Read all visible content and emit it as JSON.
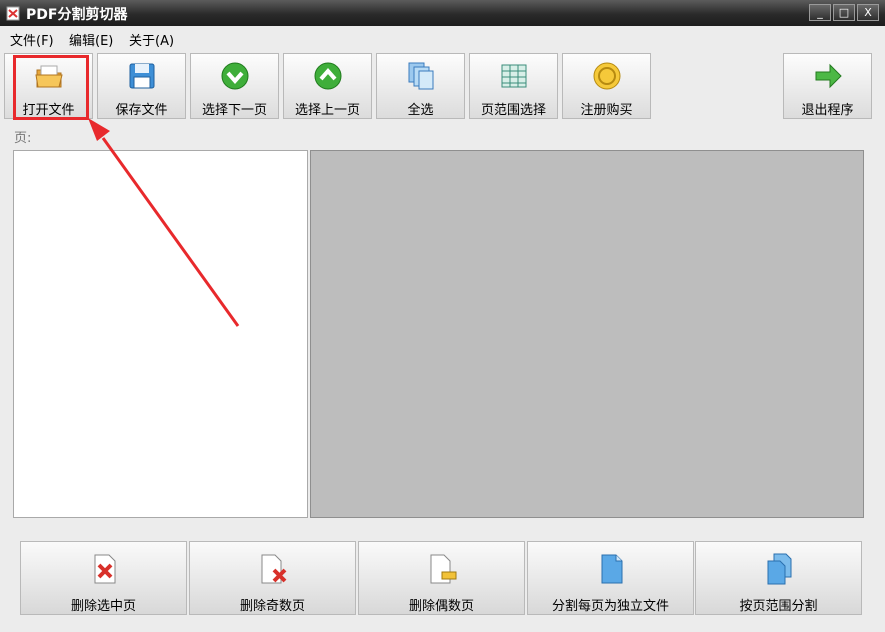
{
  "window": {
    "title": "PDF分割剪切器",
    "buttons": [
      "_",
      "□",
      "X"
    ]
  },
  "menu": [
    "文件(F)",
    "编辑(E)",
    "关于(A)"
  ],
  "toolbar": [
    {
      "label": "打开文件",
      "icon": "open-folder-icon"
    },
    {
      "label": "保存文件",
      "icon": "save-disk-icon"
    },
    {
      "label": "选择下一页",
      "icon": "down-arrow-circle-icon"
    },
    {
      "label": "选择上一页",
      "icon": "up-arrow-circle-icon"
    },
    {
      "label": "全选",
      "icon": "select-all-pages-icon"
    },
    {
      "label": "页范围选择",
      "icon": "page-range-icon"
    },
    {
      "label": "注册购买",
      "icon": "register-coin-icon"
    },
    {
      "label": "退出程序",
      "icon": "exit-arrow-icon"
    }
  ],
  "page_label": "页:",
  "bottom_buttons": [
    {
      "label": "删除选中页",
      "icon": "delete-selected-page-icon"
    },
    {
      "label": "删除奇数页",
      "icon": "delete-odd-pages-icon"
    },
    {
      "label": "删除偶数页",
      "icon": "delete-even-pages-icon"
    },
    {
      "label": "分割每页为独立文件",
      "icon": "split-each-page-icon"
    },
    {
      "label": "按页范围分割",
      "icon": "split-by-range-icon"
    }
  ],
  "colors": {
    "highlight": "#e8292c",
    "preview_bg": "#bdbdbd",
    "titlebar": "#2a2a2a"
  }
}
